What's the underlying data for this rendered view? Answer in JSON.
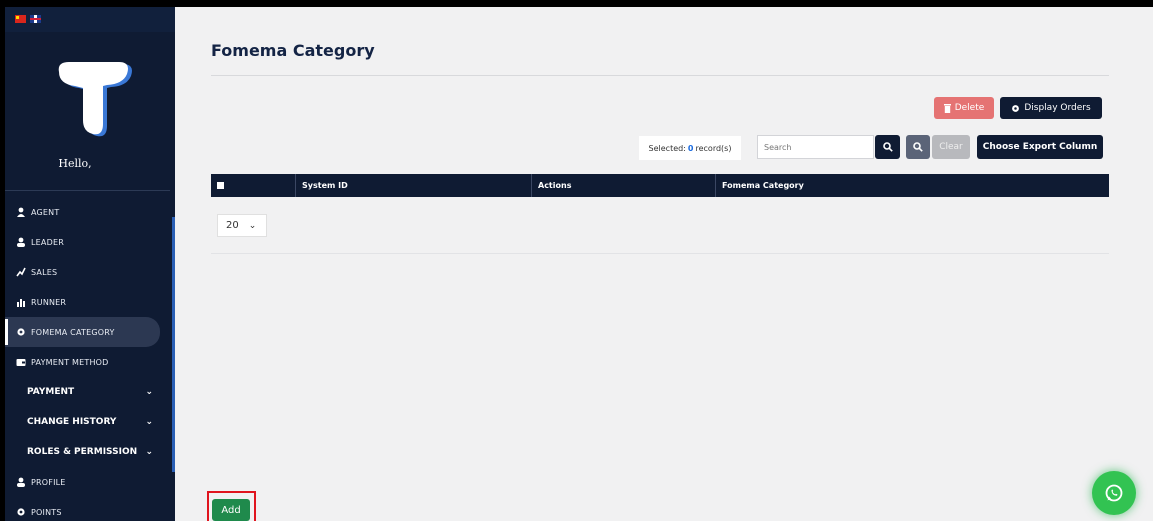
{
  "sidebar": {
    "greeting": "Hello,",
    "items": [
      {
        "label": "AGENT",
        "icon": "agent-icon"
      },
      {
        "label": "LEADER",
        "icon": "user-icon"
      },
      {
        "label": "SALES",
        "icon": "sales-icon"
      },
      {
        "label": "RUNNER",
        "icon": "chart-icon"
      },
      {
        "label": "FOMEMA CATEGORY",
        "icon": "gear-icon",
        "active": true
      },
      {
        "label": "PAYMENT METHOD",
        "icon": "wallet-icon"
      }
    ],
    "groups": [
      {
        "label": "PAYMENT"
      },
      {
        "label": "CHANGE HISTORY"
      },
      {
        "label": "ROLES & PERMISSION"
      }
    ],
    "bottom_items": [
      {
        "label": "PROFILE",
        "icon": "user-icon"
      },
      {
        "label": "POINTS",
        "icon": "gear-icon"
      }
    ]
  },
  "main": {
    "title": "Fomema Category",
    "delete_label": "Delete",
    "display_orders_label": "Display Orders",
    "selected_prefix": "Selected:",
    "selected_count": "0",
    "selected_suffix": "record(s)",
    "search_placeholder": "Search",
    "clear_label": "Clear",
    "export_label": "Choose Export Column",
    "columns": [
      "System ID",
      "Actions",
      "Fomema Category"
    ],
    "page_size": "20",
    "add_label": "Add"
  },
  "colors": {
    "navy": "#0f1b33",
    "delete": "#e57373",
    "add": "#1f8a4c",
    "whatsapp": "#32c352",
    "highlight": "#e0141e"
  }
}
